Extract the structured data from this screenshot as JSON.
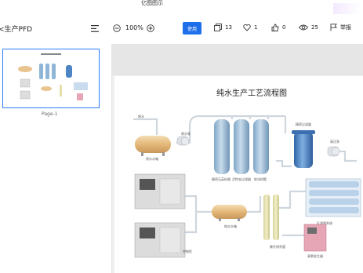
{
  "app_title": "亿图图示",
  "doc_title": "<生产PFD",
  "zoom": "100%",
  "use_button": "使用",
  "stats": {
    "pages": "13",
    "likes": "1",
    "thumbs": "0",
    "views": "25",
    "report": "举报"
  },
  "page_label": "Page-1",
  "diagram": {
    "title": "纯水生产工艺流程图",
    "labels": {
      "raw_water": "原水",
      "raw_tank": "原水水箱",
      "pump1": "原水泵",
      "filter1": "精密石英砂器",
      "filter2": "活性炭过滤器",
      "filter3": "软化树脂",
      "precision": "精密过滤器",
      "pump2": "高压泵",
      "ro": "反渗透系统",
      "tank2": "纯水水箱",
      "uv": "紫外线杀菌",
      "cabinet": "臭氧发生器",
      "ctrl": "控制柜",
      "fill": "灌装机"
    }
  },
  "colors": {
    "accent": "#1f6feb",
    "thumb_border": "#2b7cff",
    "tank_tan": "#e8c48f",
    "vessel_blue": "#8fb6d6",
    "membrane_blue": "#4d84c4",
    "cabinet_pink": "#e7a6b6"
  }
}
